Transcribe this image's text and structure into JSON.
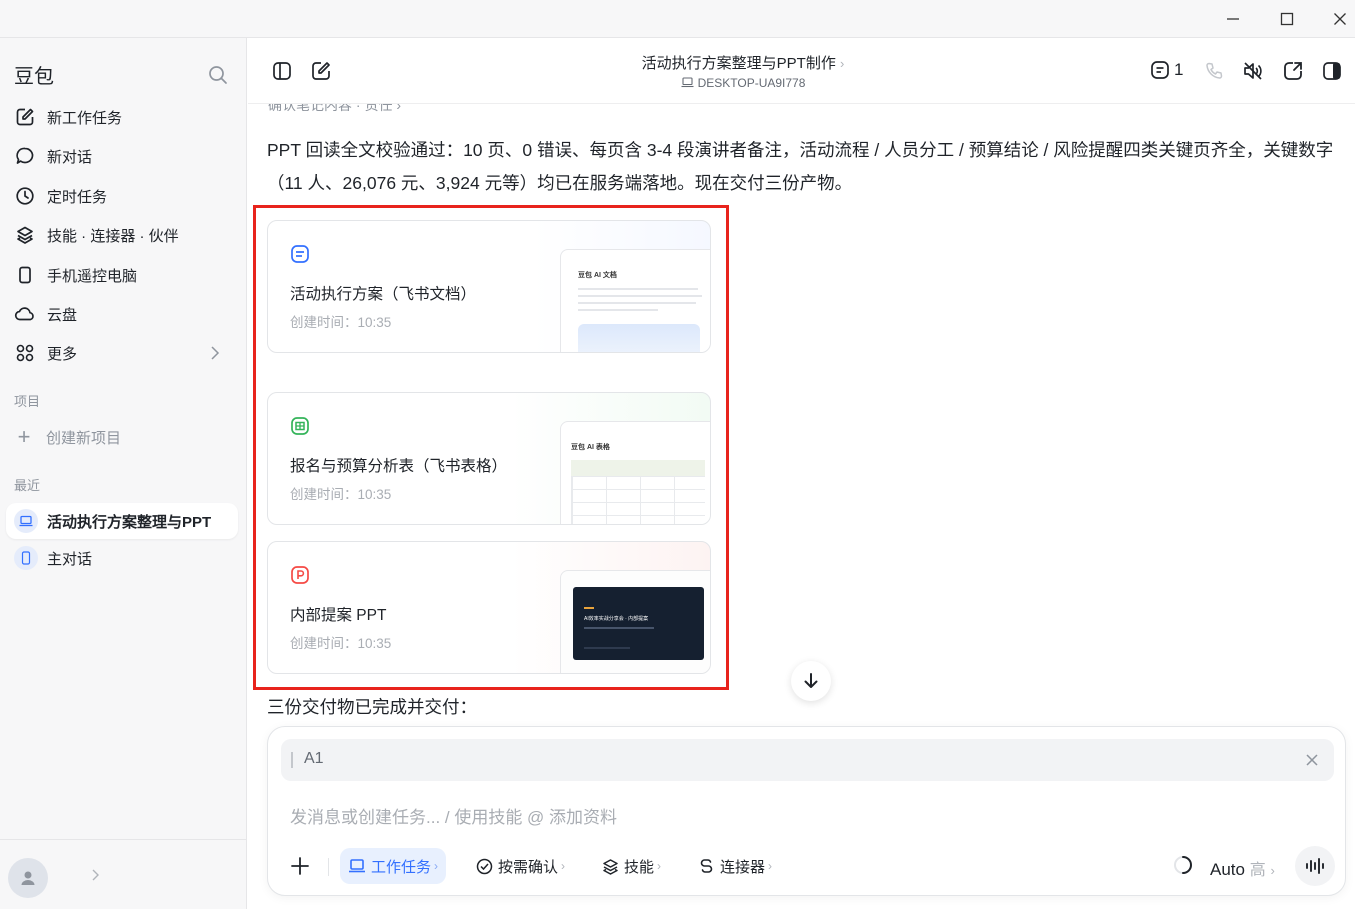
{
  "window": {
    "minimize_icon": "minimize-icon",
    "maximize_icon": "maximize-icon",
    "close_icon": "close-icon"
  },
  "sidebar": {
    "brand": "豆包",
    "nav": [
      {
        "label": "新工作任务",
        "icon": "edit-icon"
      },
      {
        "label": "新对话",
        "icon": "chat-icon"
      },
      {
        "label": "定时任务",
        "icon": "clock-icon"
      },
      {
        "label": "技能 · 连接器 · 伙伴",
        "icon": "layers-icon"
      },
      {
        "label": "手机遥控电脑",
        "icon": "phone-icon"
      },
      {
        "label": "云盘",
        "icon": "cloud-icon"
      },
      {
        "label": "更多",
        "icon": "grid-icon"
      }
    ],
    "projects_label": "项目",
    "create_project": "创建新项目",
    "recent_label": "最近",
    "recent": [
      {
        "label": "活动执行方案整理与PPT",
        "active": true
      },
      {
        "label": "主对话",
        "active": false
      }
    ]
  },
  "header": {
    "title": "活动执行方案整理与PPT制作",
    "title_arrow": "›",
    "device": "DESKTOP-UA9I778",
    "count": "1"
  },
  "content": {
    "breadcrumb_cut": "确认笔记内容 · 责任 ›",
    "paragraph": "PPT 回读全文校验通过：10 页、0 错误、每页含 3-4 段演讲者备注，活动流程 / 人员分工 / 预算结论 / 风险提醒四类关键页齐全，关键数字（11 人、26,076 元、3,924 元等）均已在服务端落地。现在交付三份产物。",
    "cards": [
      {
        "title": "活动执行方案（飞书文档）",
        "time": "创建时间：10:35",
        "icon": "doc-icon",
        "thumb_label": "豆包 AI 文档",
        "accent": "#3370ff"
      },
      {
        "title": "报名与预算分析表（飞书表格）",
        "time": "创建时间：10:35",
        "icon": "sheet-icon",
        "thumb_label": "豆包 AI 表格",
        "accent": "#34b45a"
      },
      {
        "title": "内部提案 PPT",
        "time": "创建时间：10:35",
        "icon": "ppt-icon",
        "thumb_label": "AI效率实战分享会 · 内部提案",
        "accent": "#f54a45"
      }
    ],
    "summary": "三份交付物已完成并交付："
  },
  "composer": {
    "quote": "A1",
    "placeholder": "发消息或创建任务... / 使用技能 @ 添加资料",
    "chips": [
      {
        "label": "工作任务",
        "icon": "laptop-icon",
        "active": true
      },
      {
        "label": "按需确认",
        "icon": "check-circle-icon",
        "active": false
      },
      {
        "label": "技能",
        "icon": "layers-icon",
        "active": false
      },
      {
        "label": "连接器",
        "icon": "connector-icon",
        "active": false
      }
    ],
    "chip_arrow": "›",
    "model": "Auto",
    "level": "高",
    "level_arrow": "›"
  },
  "colors": {
    "accent": "#3370ff",
    "highlight": "#e8231c",
    "sidebar_bg": "#f7f7f8"
  }
}
